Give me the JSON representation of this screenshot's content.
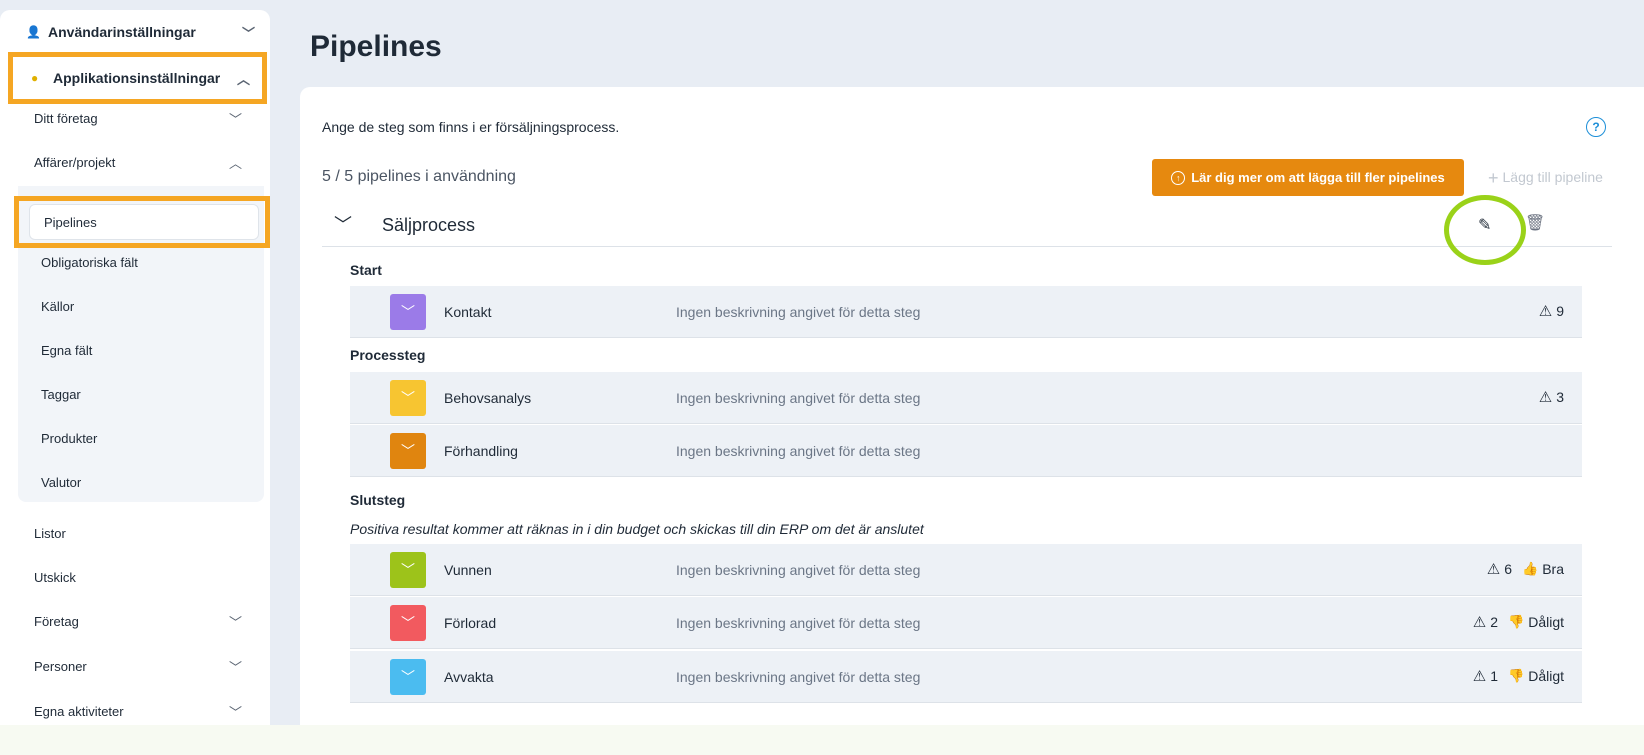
{
  "sidebar": {
    "user_settings": "Användarinställningar",
    "app_settings": "Applikationsinställningar",
    "items": {
      "ditt_foretag": "Ditt företag",
      "affarer": "Affärer/projekt",
      "listor": "Listor",
      "utskick": "Utskick",
      "foretag": "Företag",
      "personer": "Personer",
      "egna_aktiviteter": "Egna aktiviteter"
    },
    "sub_items": {
      "pipelines": "Pipelines",
      "obligatoriska": "Obligatoriska fält",
      "kallor": "Källor",
      "egna_falt": "Egna fält",
      "taggar": "Taggar",
      "produkter": "Produkter",
      "valutor": "Valutor"
    }
  },
  "main": {
    "title": "Pipelines",
    "description": "Ange de steg som finns i er försäljningsprocess.",
    "count": "5 / 5 pipelines i användning",
    "learn_button": "Lär dig mer om att lägga till fler pipelines",
    "add_pipeline": "Lägg till pipeline",
    "pipeline_name": "Säljprocess",
    "sections": {
      "start": "Start",
      "process": "Processteg",
      "end": "Slutsteg",
      "end_note": "Positiva resultat kommer att räknas in i din budget och skickas till din ERP om det är anslutet"
    },
    "stage_desc": "Ingen beskrivning angivet för detta steg",
    "stages": {
      "kontakt": {
        "name": "Kontakt",
        "count": "9",
        "color": "#9b7be8"
      },
      "behovsanalys": {
        "name": "Behovsanalys",
        "count": "3",
        "color": "#f7c531"
      },
      "forhandling": {
        "name": "Förhandling",
        "color": "#e0850f"
      },
      "vunnen": {
        "name": "Vunnen",
        "count": "6",
        "result": "Bra",
        "color": "#9dc31a"
      },
      "forlorad": {
        "name": "Förlorad",
        "count": "2",
        "result": "Dåligt",
        "color": "#f25a5f"
      },
      "avvakta": {
        "name": "Avvakta",
        "count": "1",
        "result": "Dåligt",
        "color": "#4bbcf0"
      }
    }
  }
}
